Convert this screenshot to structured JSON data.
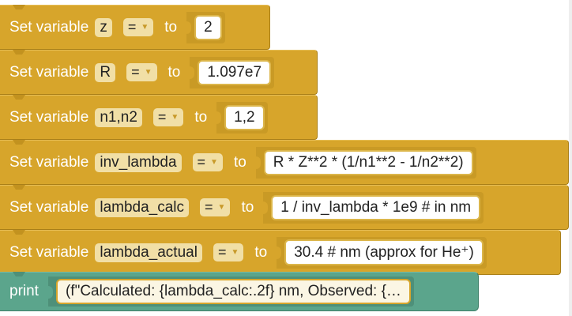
{
  "blocks": [
    {
      "kind": "set_variable",
      "label": "Set variable",
      "variable": "z",
      "operator": "=",
      "to_label": "to",
      "value": "2"
    },
    {
      "kind": "set_variable",
      "label": "Set variable",
      "variable": "R",
      "operator": "=",
      "to_label": "to",
      "value": "1.097e7"
    },
    {
      "kind": "set_variable",
      "label": "Set variable",
      "variable": "n1,n2",
      "operator": "=",
      "to_label": "to",
      "value": "1,2"
    },
    {
      "kind": "set_variable",
      "label": "Set variable",
      "variable": "inv_lambda",
      "operator": "=",
      "to_label": "to",
      "value": "R * Z**2 * (1/n1**2 - 1/n2**2)"
    },
    {
      "kind": "set_variable",
      "label": "Set variable",
      "variable": "lambda_calc",
      "operator": "=",
      "to_label": "to",
      "value": "1 / inv_lambda * 1e9  # in nm"
    },
    {
      "kind": "set_variable",
      "label": "Set variable",
      "variable": "lambda_actual",
      "operator": "=",
      "to_label": "to",
      "value": "30.4  # nm (approx for He⁺)"
    },
    {
      "kind": "print",
      "label": "print",
      "value": "(f\"Calculated: {lambda_calc:.2f} nm, Observed: {…"
    }
  ],
  "colors": {
    "set_variable_block": "#d7a52b",
    "print_block": "#5ba58c",
    "field_background": "#f1dfa6",
    "value_background": "#ffffff"
  }
}
